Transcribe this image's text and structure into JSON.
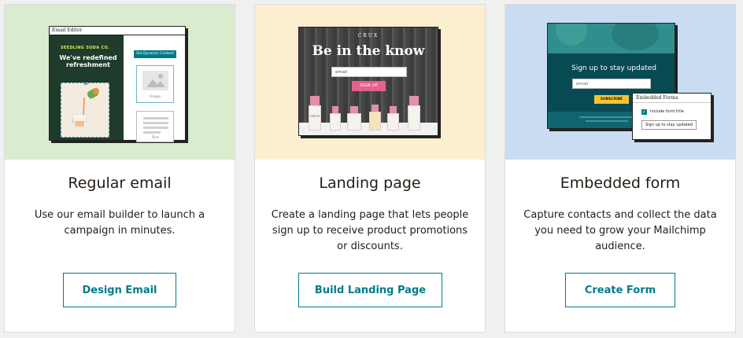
{
  "colors": {
    "page_bg": "#f0f0ef",
    "accent": "#007c89",
    "email_preview_bg": "#d9ecd0",
    "landing_preview_bg": "#fbefd0",
    "form_preview_bg": "#c9dcf2"
  },
  "cards": [
    {
      "title": "Regular email",
      "description": "Use our email builder to launch a campaign in minutes.",
      "button": "Design Email",
      "preview": {
        "window_title": "Email Editor",
        "brand": "SEEDLING SODA CO.",
        "headline": "We've redefined refreshment",
        "dynamic_button": "Set Dynamic Content",
        "image_label": "Image",
        "text_label": "Text"
      }
    },
    {
      "title": "Landing page",
      "description": "Create a landing page that lets people sign up to receive product promotions or discounts.",
      "button": "Build Landing Page",
      "preview": {
        "logo": "CRUX",
        "headline": "Be in the know",
        "email_placeholder": "email",
        "signup_button": "SIGN UP",
        "bottle_label": "CRUX"
      }
    },
    {
      "title": "Embedded form",
      "description": "Capture contacts and collect the data you need to grow your Mailchimp audience.",
      "button": "Create Form",
      "preview": {
        "headline": "Sign up to stay updated",
        "email_placeholder": "email",
        "subscribe_button": "SUBSCRIBE",
        "panel_title": "Embedded Forms",
        "checkbox_label": "Include form title",
        "panel_button": "Sign up to stay updated"
      }
    }
  ]
}
